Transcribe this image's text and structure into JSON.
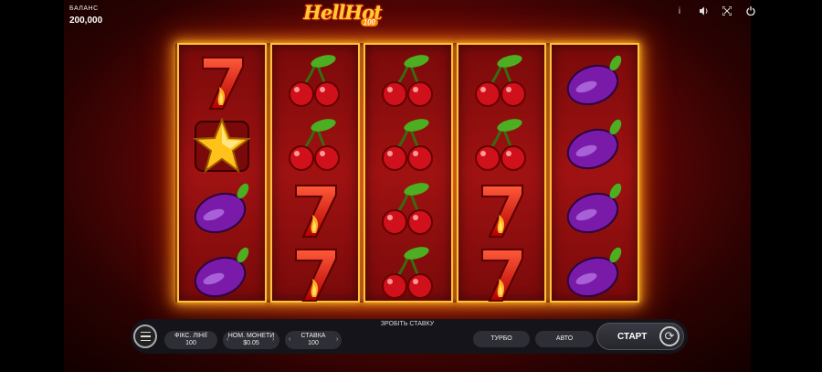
{
  "balance": {
    "label": "БАЛАНС",
    "value": "200,000"
  },
  "logo": {
    "title": "HellHot",
    "badge": "100"
  },
  "top_icons": [
    "info-icon",
    "sound-icon",
    "fullscreen-icon",
    "power-icon"
  ],
  "reels": [
    [
      "seven",
      "star",
      "plum",
      "plum"
    ],
    [
      "cherry",
      "cherry",
      "seven",
      "seven"
    ],
    [
      "cherry",
      "cherry",
      "cherry",
      "cherry"
    ],
    [
      "cherry",
      "cherry",
      "seven",
      "seven"
    ],
    [
      "plum",
      "plum",
      "plum",
      "plum"
    ]
  ],
  "controls": {
    "hint": "ЗРОБІТЬ СТАВКУ",
    "lines": {
      "label": "ФІКС. ЛІНІЇ",
      "value": "100"
    },
    "coin": {
      "label": "НОМ. МОНЕТИ",
      "value": "$0.05"
    },
    "bet": {
      "label": "СТАВКА",
      "value": "100"
    },
    "turbo": "ТУРБО",
    "auto": "АВТО",
    "start": "СТАРТ"
  },
  "colors": {
    "frame_gold": "#ffc23a",
    "reel_red": "#a01212"
  }
}
